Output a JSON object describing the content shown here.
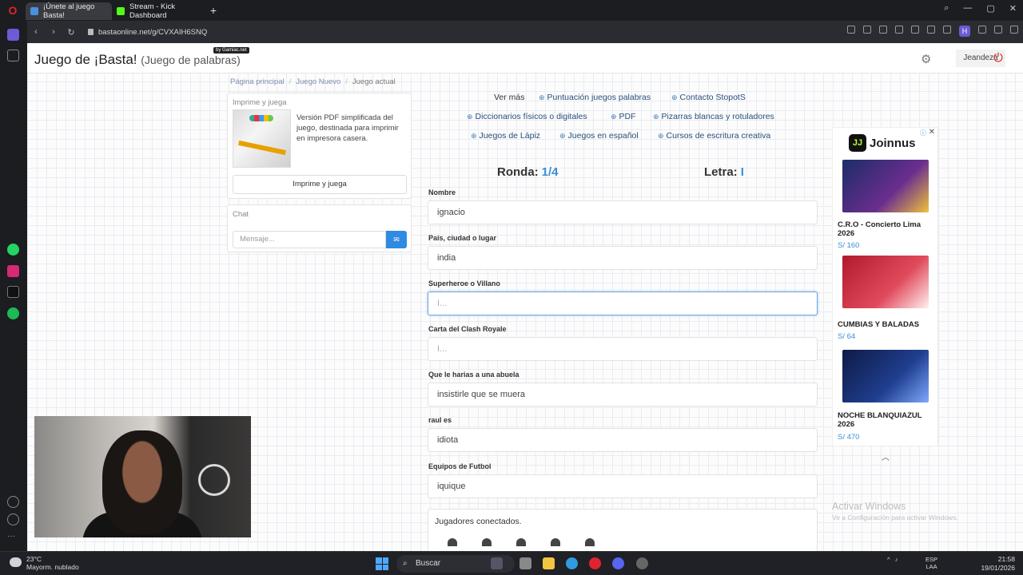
{
  "browser": {
    "tabs": [
      {
        "label": "¡Únete al juego Basta!",
        "active": true
      },
      {
        "label": "Stream - Kick Dashboard",
        "active": false
      }
    ],
    "url": "bastaonline.net/g/CVXAIH6SNQ"
  },
  "header": {
    "title": "Juego de ¡Basta!",
    "subtitle": "(Juego de palabras)",
    "badge": "by Gamiac.net",
    "username": "Jeandeza"
  },
  "breadcrumb": [
    "Página principal",
    "Juego Nuevo",
    "Juego actual"
  ],
  "print_panel": {
    "title": "Imprime y juega",
    "description": "Versión PDF simplificada del juego, destinada para imprimir en impresora casera.",
    "button": "Imprime y juega"
  },
  "chat": {
    "title": "Chat",
    "placeholder": "Mensaje..."
  },
  "links": {
    "ver_mas": "Ver más",
    "puntuacion": "Puntuación juegos palabras",
    "contacto": "Contacto StopotS",
    "diccionarios": "Diccionarios físicos o digitales",
    "pdf": "PDF",
    "pizarras": "Pizarras blancas y rotuladores",
    "lapiz": "Juegos de Lápiz",
    "espanol": "Juegos en español",
    "cursos": "Cursos de escritura creativa"
  },
  "game": {
    "ronda_label": "Ronda:",
    "ronda_value": "1/4",
    "letra_label": "Letra:",
    "letra_value": "I",
    "fields": [
      {
        "label": "Nombre",
        "value": "ignacio"
      },
      {
        "label": "País, ciudad o lugar",
        "value": "india"
      },
      {
        "label": "Superheroe o Villano",
        "value": "I..."
      },
      {
        "label": "Carta del Clash Royale",
        "value": "I..."
      },
      {
        "label": "Que le harias a una abuela",
        "value": "insistirle que se muera"
      },
      {
        "label": "raul es",
        "value": "idiota"
      },
      {
        "label": "Equipos de Futbol",
        "value": "iquique"
      }
    ],
    "players_title": "Jugadores conectados."
  },
  "ad": {
    "brand": "Joinnus",
    "items": [
      {
        "name": "C.R.O - Concierto Lima 2026",
        "price": "S/ 160",
        "color": "#1b2d66"
      },
      {
        "name": "CUMBIAS Y BALADAS",
        "price": "S/ 64",
        "color": "#b01a2c"
      },
      {
        "name": "NOCHE BLANQUIAZUL 2026",
        "price": "S/ 470",
        "color": "#1f3f8f"
      }
    ]
  },
  "watermark": {
    "line1": "Activar Windows",
    "line2": "Ve a Configuración para activar Windows."
  },
  "taskbar": {
    "temp": "23°C",
    "weather": "Mayorm. nublado",
    "search": "Buscar",
    "lang1": "ESP",
    "lang2": "LAA",
    "time": "21:58",
    "date": "19/01/2026"
  }
}
